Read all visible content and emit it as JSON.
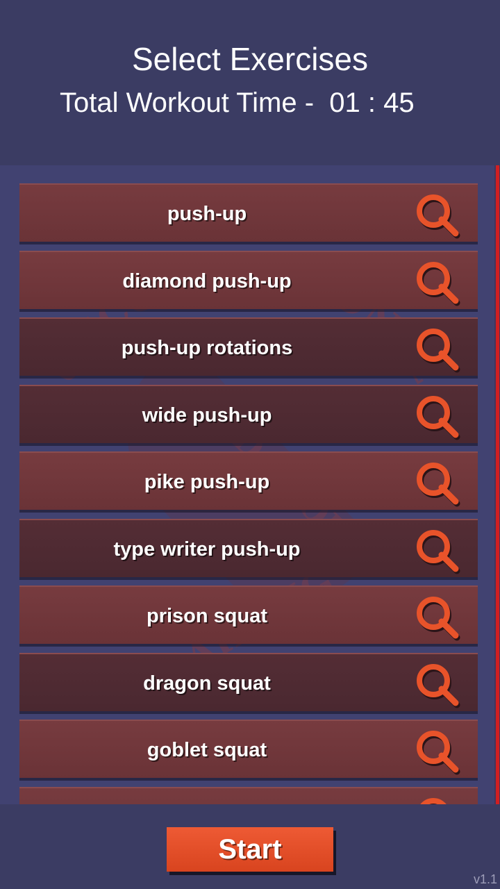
{
  "header": {
    "title": "Select Exercises",
    "total_workout_time": "Total Workout Time -  01 : 45"
  },
  "watermark": {
    "text_top": "UNCONVENTIONAL",
    "text_mid": "D-SPORTS",
    "text_bottom": "TRAINING"
  },
  "exercises": [
    {
      "label": "push-up",
      "icon": "magnifier-icon"
    },
    {
      "label": "diamond push-up",
      "icon": "magnifier-icon"
    },
    {
      "label": "push-up rotations",
      "icon": "magnifier-icon"
    },
    {
      "label": "wide push-up",
      "icon": "magnifier-icon"
    },
    {
      "label": "pike push-up",
      "icon": "magnifier-icon"
    },
    {
      "label": "type writer push-up",
      "icon": "magnifier-icon"
    },
    {
      "label": "prison squat",
      "icon": "magnifier-icon"
    },
    {
      "label": "dragon squat",
      "icon": "magnifier-icon"
    },
    {
      "label": "goblet squat",
      "icon": "magnifier-icon"
    },
    {
      "label": "",
      "icon": "magnifier-icon"
    }
  ],
  "footer": {
    "start_label": "Start",
    "version": "v1.1"
  },
  "colors": {
    "background": "#3b3c63",
    "row_light": "#773b3f",
    "row_dark": "#542d35",
    "accent": "#e8532a",
    "scrollbar": "#d11f22"
  }
}
